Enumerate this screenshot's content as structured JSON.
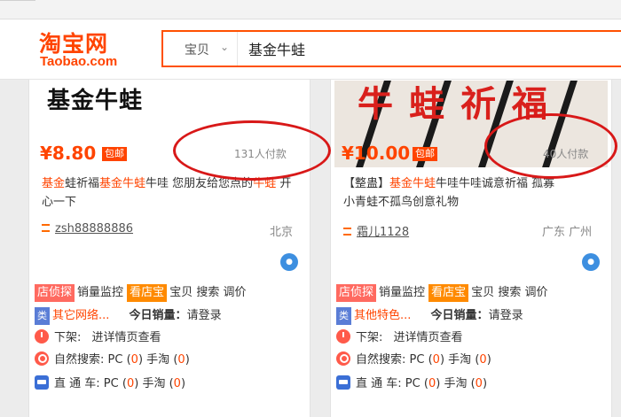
{
  "header": {
    "logo_cn": "淘宝网",
    "logo_en": "Taobao.com",
    "search_category": "宝贝",
    "search_query": "基金牛蛙"
  },
  "products": [
    {
      "image_text": "基金牛蛙",
      "price": "¥8.80",
      "badge": "包邮",
      "sold": "131人付款",
      "title_parts": [
        {
          "text": "基金",
          "hl": true
        },
        {
          "text": "蛙祈福",
          "hl": false
        },
        {
          "text": "基金牛蛙",
          "hl": true
        },
        {
          "text": "牛哇 您朋友给您点的",
          "hl": false
        },
        {
          "text": "牛蛙",
          "hl": true
        },
        {
          "text": " 开心一下",
          "hl": false
        }
      ],
      "shop": "zsh88888886",
      "location": "北京",
      "tools": {
        "tag1": "店侦探",
        "t1": "销量监控",
        "tag2": "看店宝",
        "t2": "宝贝",
        "t3": "搜索",
        "t4": "调价",
        "cat_tag": "类",
        "category": "其它网络...",
        "sales_label": "今日销量：",
        "sales_value": "请登录",
        "offshelf_label": "下架:",
        "offshelf_value": "进详情页查看",
        "natural_label": "自然搜索:",
        "natural_pc": "PC",
        "natural_pc_val": "0",
        "natural_mobile": "手淘",
        "natural_mobile_val": "0",
        "ztc_label": "直 通 车:",
        "ztc_pc": "PC",
        "ztc_pc_val": "0",
        "ztc_mobile": "手淘",
        "ztc_mobile_val": "0"
      }
    },
    {
      "image_text": "牛蛙祈福",
      "price": "¥10.00",
      "badge": "包邮",
      "sold": "40人付款",
      "title_parts": [
        {
          "text": "【整蛊】",
          "hl": false
        },
        {
          "text": "基金牛蛙",
          "hl": true
        },
        {
          "text": "牛哇牛哇诚意祈福 孤寡",
          "hl": false
        },
        {
          "text": "小青蛙不孤鸟创意礼物",
          "hl": false
        }
      ],
      "shop": "霜儿1128",
      "location": "广东 广州",
      "tools": {
        "tag1": "店侦探",
        "t1": "销量监控",
        "tag2": "看店宝",
        "t2": "宝贝",
        "t3": "搜索",
        "t4": "调价",
        "cat_tag": "类",
        "category": "其他特色...",
        "sales_label": "今日销量：",
        "sales_value": "请登录",
        "offshelf_label": "下架:",
        "offshelf_value": "进详情页查看",
        "natural_label": "自然搜索:",
        "natural_pc": "PC",
        "natural_pc_val": "0",
        "natural_mobile": "手淘",
        "natural_mobile_val": "0",
        "ztc_label": "直 通 车:",
        "ztc_pc": "PC",
        "ztc_pc_val": "0",
        "ztc_mobile": "手淘",
        "ztc_mobile_val": "0"
      }
    }
  ],
  "colors": {
    "brand": "#ff4400",
    "annotation": "#d81818",
    "tag_red": "#ff6a60",
    "tag_orange": "#ff8a00",
    "tag_blue": "#5a7dd6"
  }
}
